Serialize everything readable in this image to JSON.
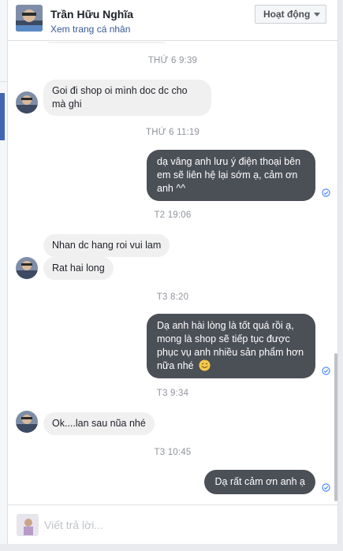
{
  "header": {
    "name": "Trần Hữu Nghĩa",
    "profile_link": "Xem trang cá nhân",
    "status": "Hoạt động"
  },
  "conversation": {
    "t1": "THỨ 6 9:39",
    "m1": "Goi đi shop oi mình doc dc cho mà ghi",
    "t2": "THỨ 6 11:19",
    "m2": "dạ vâng anh lưu ý điện thoại bên em sẽ liên hệ lại sớm ạ, cảm ơn anh ^^",
    "t3": "T2 19:06",
    "m3": "Nhan dc hang roi vui lam",
    "m4": "Rat hai long",
    "t4": "T3 8:20",
    "m5": "Dạ anh hài lòng là tốt quá rồi ạ, mong là shop sẽ tiếp tục được phục vụ anh nhiều sản phẩm hơn nữa nhé",
    "t5": "T3 9:34",
    "m6": "Ok....lan sau nũa nhé",
    "t6": "T3 10:45",
    "m7": "Dạ rất cảm ơn anh ạ"
  },
  "composer": {
    "placeholder": "Viết trả lời..."
  },
  "icons": {
    "seen": "check-circle-icon",
    "emoji": "smiling-face-emoji",
    "caret": "caret-down-icon"
  },
  "colors": {
    "incoming_bubble": "#f1f0f0",
    "outgoing_bubble": "#4b4f56",
    "link": "#385898",
    "seen_check": "#4080ff"
  }
}
